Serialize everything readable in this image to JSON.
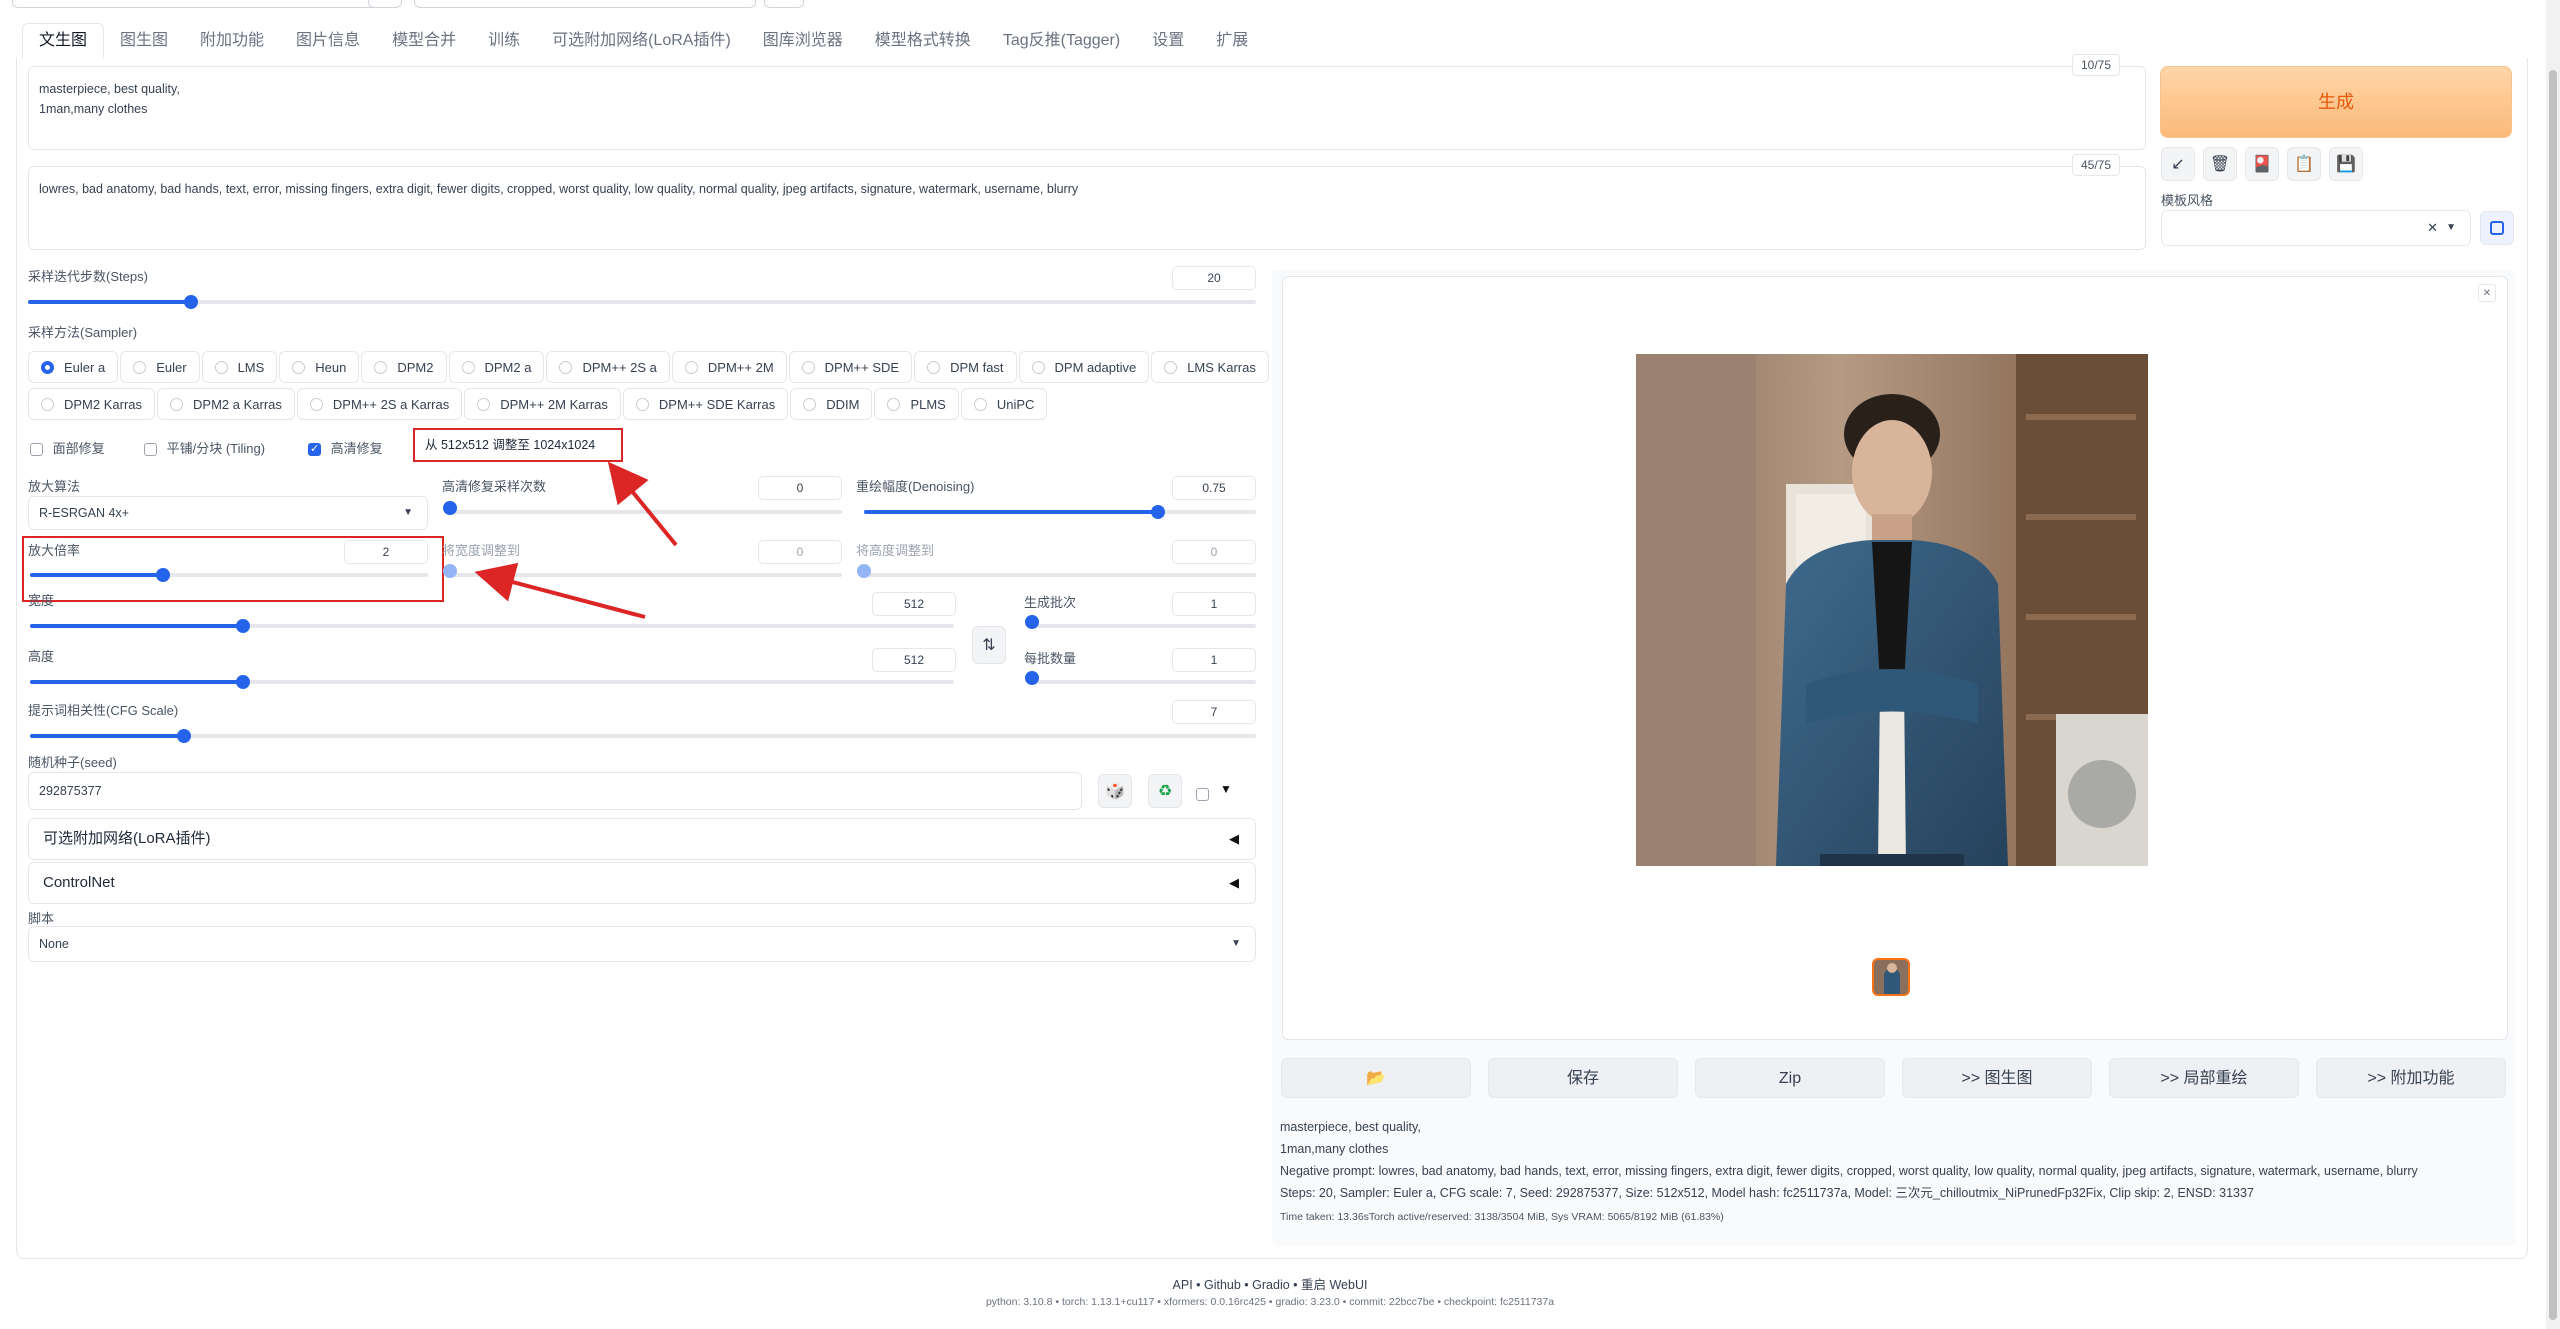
{
  "tabs": [
    "文生图",
    "图生图",
    "附加功能",
    "图片信息",
    "模型合并",
    "训练",
    "可选附加网络(LoRA插件)",
    "图库浏览器",
    "模型格式转换",
    "Tag反推(Tagger)",
    "设置",
    "扩展"
  ],
  "prompt": {
    "positive": "masterpiece, best quality,\n1man,many clothes",
    "positive_counter": "10/75",
    "negative": "lowres, bad anatomy, bad hands, text, error, missing fingers, extra digit, fewer digits, cropped, worst quality, low quality, normal quality, jpeg artifacts, signature, watermark, username, blurry",
    "negative_counter": "45/75"
  },
  "generate": {
    "label": "生成",
    "tools": [
      "↙",
      "🗑",
      "🎴",
      "📋",
      "💾"
    ],
    "style_label": "模板风格",
    "style_clear": "✕"
  },
  "steps": {
    "label": "采样迭代步数(Steps)",
    "value": "20",
    "fraction": 0.133
  },
  "sampler": {
    "label": "采样方法(Sampler)",
    "row1": [
      "Euler a",
      "Euler",
      "LMS",
      "Heun",
      "DPM2",
      "DPM2 a",
      "DPM++ 2S a",
      "DPM++ 2M",
      "DPM++ SDE",
      "DPM fast",
      "DPM adaptive",
      "LMS Karras"
    ],
    "row2": [
      "DPM2 Karras",
      "DPM2 a Karras",
      "DPM++ 2S a Karras",
      "DPM++ 2M Karras",
      "DPM++ SDE Karras",
      "DDIM",
      "PLMS",
      "UniPC"
    ],
    "selected": "Euler a"
  },
  "options": {
    "restore_faces": "面部修复",
    "tiling": "平铺/分块 (Tiling)",
    "hires_fix": "高清修复",
    "hires_note": "从 512x512 调整至 1024x1024"
  },
  "hires": {
    "upscaler_label": "放大算法",
    "upscaler_value": "R-ESRGAN 4x+",
    "hires_steps_label": "高清修复采样次数",
    "hires_steps_value": "0",
    "denoise_label": "重绘幅度(Denoising)",
    "denoise_value": "0.75",
    "denoise_fraction": 0.75,
    "scale_label": "放大倍率",
    "scale_value": "2",
    "scale_fraction": 0.333,
    "resize_w_label": "将宽度调整到",
    "resize_w_value": "0",
    "resize_h_label": "将高度调整到",
    "resize_h_value": "0"
  },
  "size": {
    "width_label": "宽度",
    "width_value": "512",
    "width_fraction": 0.231,
    "height_label": "高度",
    "height_value": "512",
    "height_fraction": 0.231,
    "swap_icon": "⇅",
    "batch_count_label": "生成批次",
    "batch_count_value": "1",
    "batch_size_label": "每批数量",
    "batch_size_value": "1"
  },
  "cfg": {
    "label": "提示词相关性(CFG Scale)",
    "value": "7",
    "fraction": 0.207
  },
  "seed": {
    "label": "随机种子(seed)",
    "value": "292875377",
    "dice": "🎲",
    "recycle": "♻",
    "extra_arrow": "▼"
  },
  "accordions": [
    {
      "label": "可选附加网络(LoRA插件)",
      "arrow": "◀"
    },
    {
      "label": "ControlNet",
      "arrow": "◀"
    }
  ],
  "script": {
    "label": "脚本",
    "value": "None"
  },
  "output": {
    "close_icon": "✕",
    "buttons": [
      "📂",
      "保存",
      "Zip",
      ">> 图生图",
      ">> 局部重绘",
      ">> 附加功能"
    ],
    "info_lines": [
      "masterpiece, best quality,",
      "1man,many clothes",
      "Negative prompt: lowres, bad anatomy, bad hands, text, error, missing fingers, extra digit, fewer digits, cropped, worst quality, low quality, normal quality, jpeg artifacts, signature, watermark, username, blurry",
      "Steps: 20, Sampler: Euler a, CFG scale: 7, Seed: 292875377, Size: 512x512, Model hash: fc2511737a, Model: 三次元_chilloutmix_NiPrunedFp32Fix, Clip skip: 2, ENSD: 31337"
    ],
    "time_line": "Time taken: 13.36sTorch active/reserved: 3138/3504 MiB, Sys VRAM: 5065/8192 MiB (61.83%)"
  },
  "footer": {
    "links": "API  •  Github  •  Gradio  •  重启 WebUI",
    "versions": "python: 3.10.8  •  torch: 1.13.1+cu117  •  xformers: 0.0.16rc425  •  gradio: 3.23.0  •  commit: 22bcc7be  •  checkpoint: fc2511737a"
  },
  "colors": {
    "accent": "#2563eb",
    "generate": "#fbb979",
    "annotation": "#dc2626"
  }
}
